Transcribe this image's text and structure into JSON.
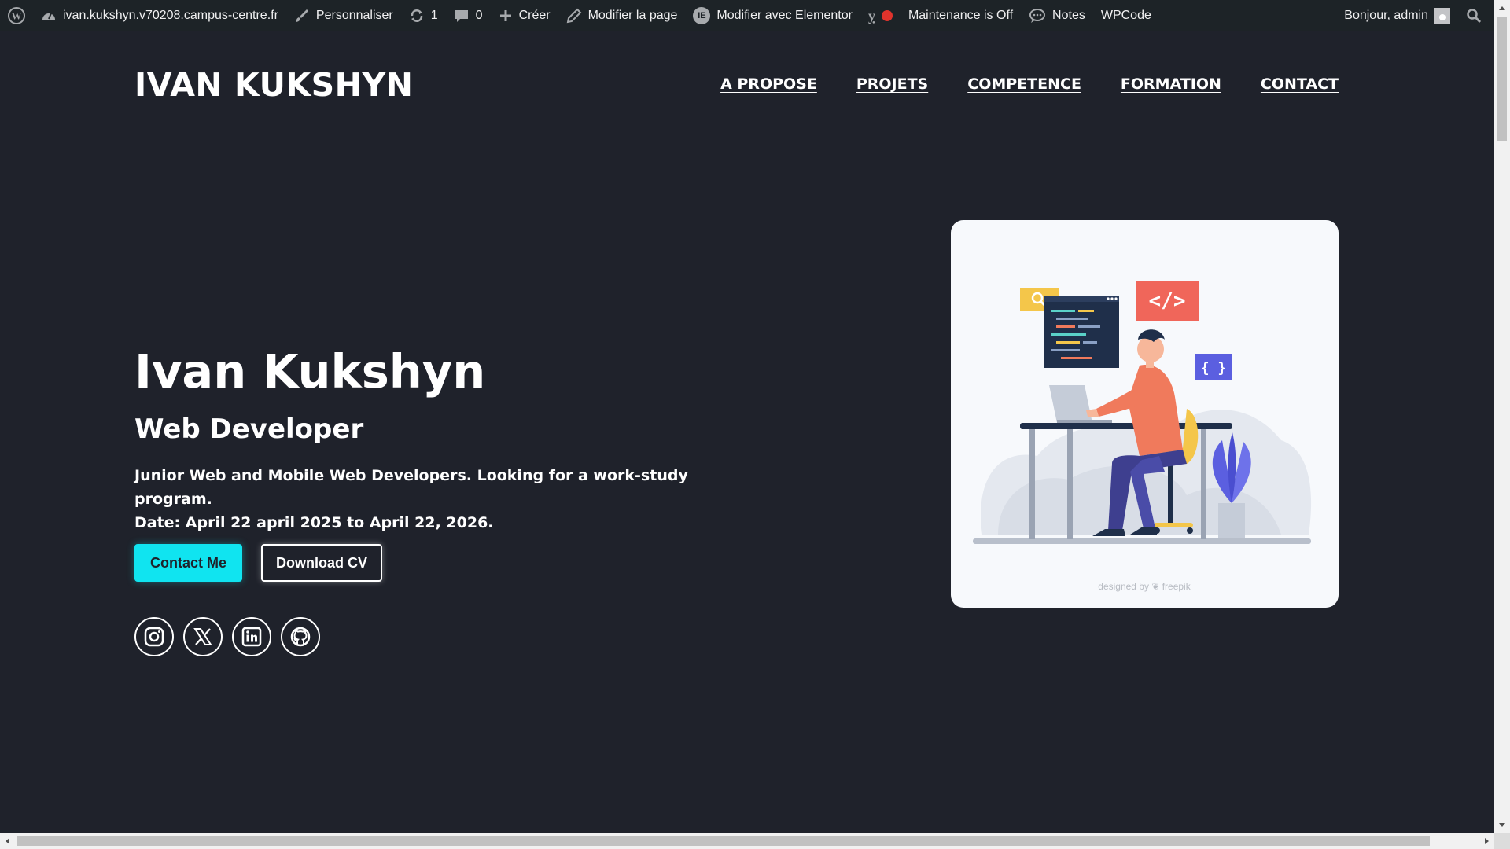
{
  "adminbar": {
    "site": "ivan.kukshyn.v70208.campus-centre.fr",
    "customize": "Personnaliser",
    "updates": "1",
    "comments": "0",
    "new": "Créer",
    "edit_page": "Modifier la page",
    "elementor": "Modifier avec Elementor",
    "maintenance": "Maintenance is Off",
    "notes": "Notes",
    "wpcode": "WPCode",
    "greeting": "Bonjour, admin",
    "maintenance_status_color": "#e0332c"
  },
  "header": {
    "brand": "IVAN KUKSHYN",
    "nav": [
      "A PROPOSE",
      "PROJETS",
      "COMPETENCE",
      "FORMATION",
      "CONTACT"
    ]
  },
  "hero": {
    "name": "Ivan Kukshyn",
    "role": "Web Developer",
    "description_line1": "Junior Web and Mobile Web Developers. Looking for a work-study program.",
    "description_line2": "Date: April 22 april 2025 to April 22, 2026.",
    "contact_button": "Contact Me",
    "cv_button": "Download CV",
    "accent_color": "#10e4f0",
    "socials": [
      "instagram-icon",
      "x-icon",
      "linkedin-icon",
      "github-icon"
    ]
  },
  "illustration": {
    "credit": "designed by ❦ freepik",
    "badge_code": "</>",
    "badge_braces": "{ }"
  }
}
